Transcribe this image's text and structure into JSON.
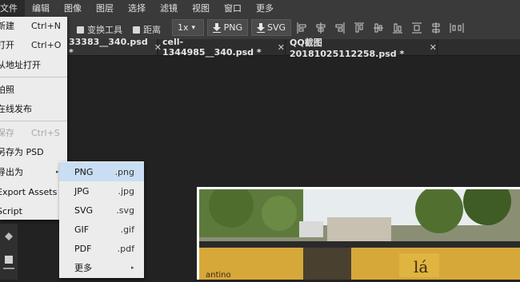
{
  "menubar": {
    "items": [
      {
        "label": "文件",
        "active": true
      },
      {
        "label": "编辑"
      },
      {
        "label": "图像"
      },
      {
        "label": "图层"
      },
      {
        "label": "选择"
      },
      {
        "label": "滤镜"
      },
      {
        "label": "视图"
      },
      {
        "label": "窗口"
      },
      {
        "label": "更多"
      }
    ]
  },
  "toolbar": {
    "transform_tools_label": "变换工具",
    "distance_label": "距离",
    "zoom_value": "1x",
    "png_label": "PNG",
    "svg_label": "SVG"
  },
  "tabs": [
    {
      "label": "33383__340.psd *",
      "close": "✕"
    },
    {
      "label": "cell-1344985__340.psd *",
      "close": "✕"
    },
    {
      "label": "QQ截图20181025112258.psd *",
      "close": "✕"
    }
  ],
  "file_menu": {
    "items": [
      {
        "label": "新建",
        "shortcut": "Ctrl+N"
      },
      {
        "label": "打开",
        "shortcut": "Ctrl+O"
      },
      {
        "label": "从地址打开",
        "shortcut": ""
      },
      {
        "label": "拍照",
        "shortcut": ""
      },
      {
        "label": "在线发布",
        "shortcut": ""
      },
      {
        "label": "保存",
        "shortcut": "Ctrl+S",
        "disabled": true
      },
      {
        "label": "另存为 PSD",
        "shortcut": ""
      },
      {
        "label": "导出为",
        "shortcut": "",
        "submenu": true
      },
      {
        "label": "Export Assets",
        "shortcut": ""
      },
      {
        "label": "Script",
        "shortcut": ""
      }
    ]
  },
  "export_submenu": {
    "items": [
      {
        "label": "PNG",
        "ext": ".png",
        "active": true
      },
      {
        "label": "JPG",
        "ext": ".jpg"
      },
      {
        "label": "SVG",
        "ext": ".svg"
      },
      {
        "label": "GIF",
        "ext": ".gif"
      },
      {
        "label": "PDF",
        "ext": ".pdf"
      },
      {
        "label": "更多",
        "ext": "",
        "submenu": true
      }
    ]
  },
  "icons": {
    "submenu_arrow": "▸",
    "dropdown_arrow": "▾"
  },
  "canvas": {
    "sign_text": "lá",
    "sign_text_2": "antino"
  },
  "colors": {
    "menubar_bg": "#3a3a3a",
    "workspace_bg": "#222222",
    "menu_bg": "#ececec",
    "menu_highlight": "#c9def2"
  }
}
